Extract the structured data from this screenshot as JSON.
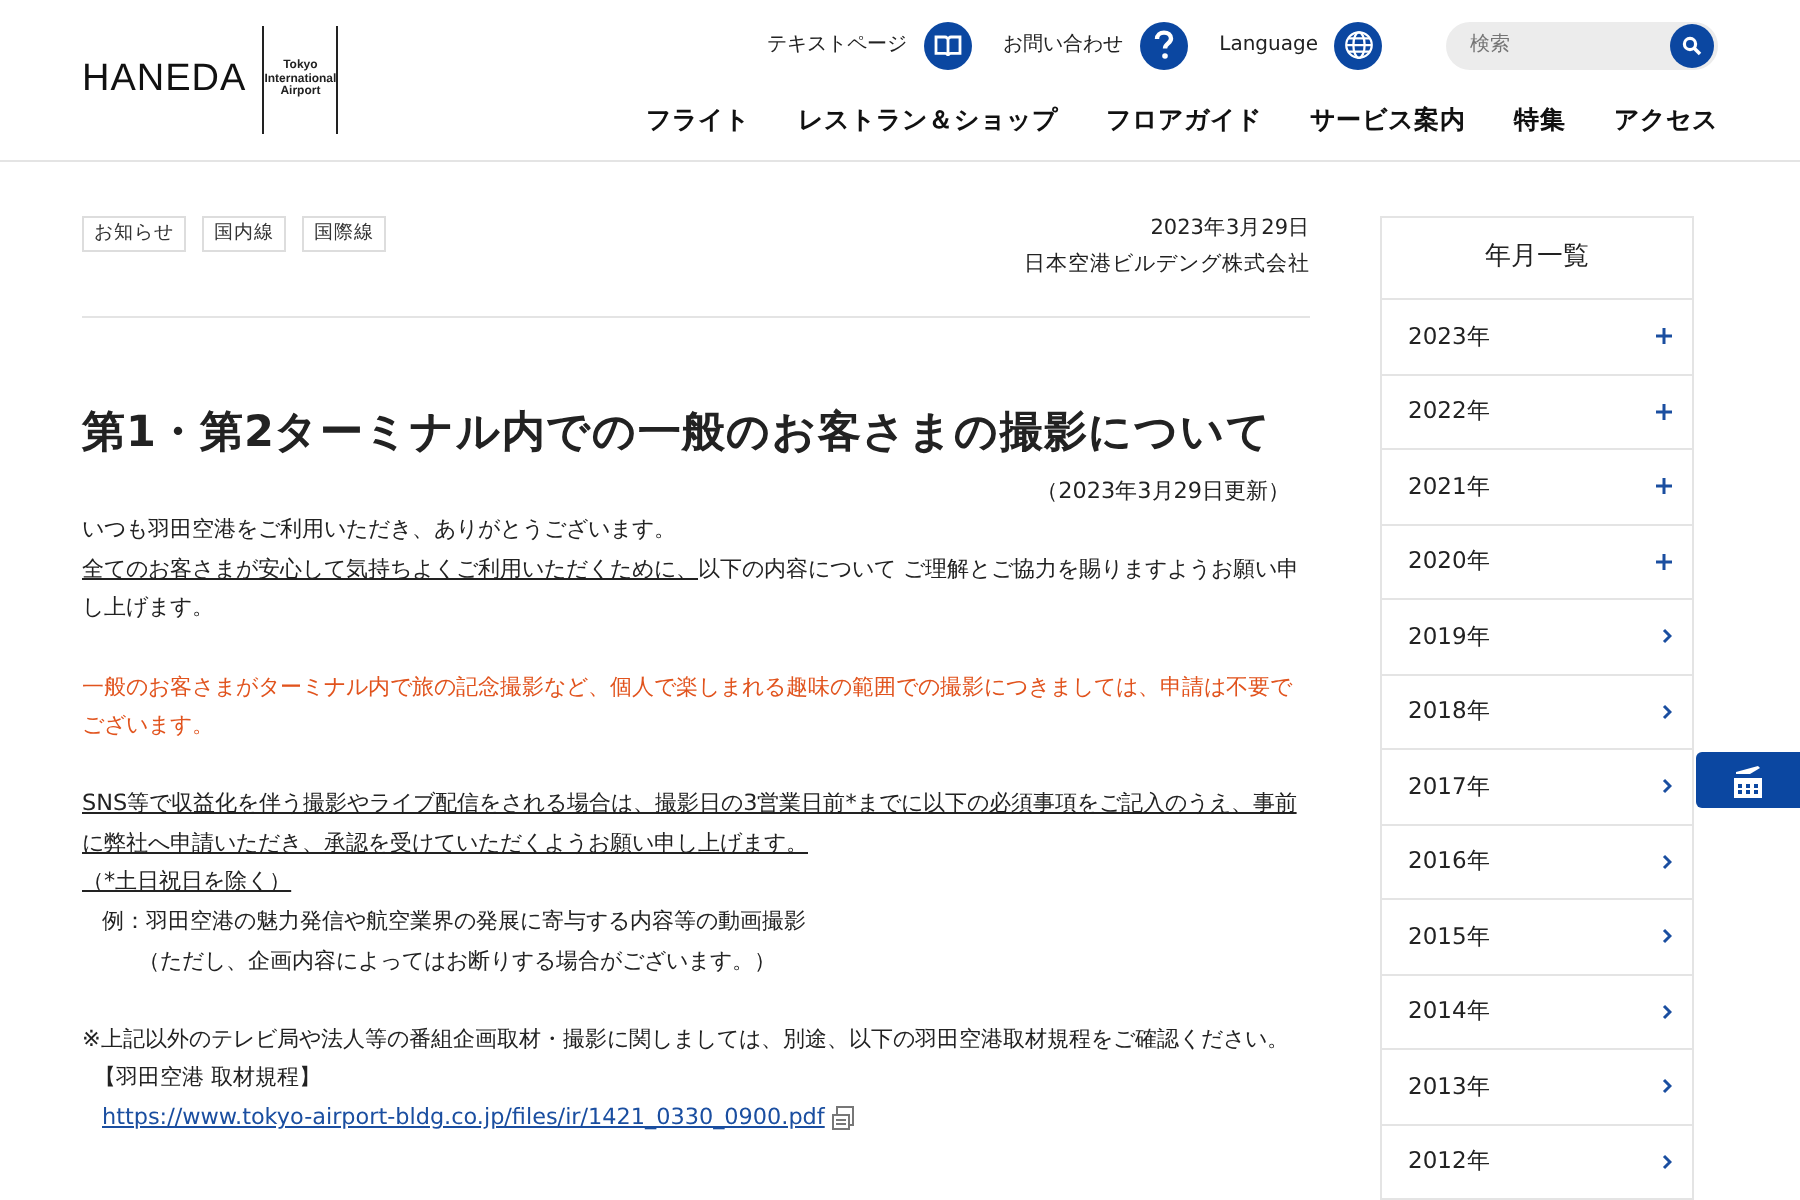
{
  "logo": {
    "name": "HANEDA",
    "subtitle": "Tokyo International Airport"
  },
  "utility_links": [
    {
      "label": "テキストページ"
    },
    {
      "label": "お問い合わせ"
    },
    {
      "label": "Language"
    }
  ],
  "search": {
    "placeholder": "検索"
  },
  "nav": [
    "フライト",
    "レストラン＆ショップ",
    "フロアガイド",
    "サービス案内",
    "特集",
    "アクセス"
  ],
  "article": {
    "tags": [
      "お知らせ",
      "国内線",
      "国際線"
    ],
    "date": "2023年3月29日",
    "author": "日本空港ビルデング株式会社",
    "title": "第1・第2ターミナル内での一般のお客さまの撮影について",
    "updated": "（2023年3月29日更新）",
    "paragraphs": [
      {
        "lines": [
          {
            "kind": "plain",
            "text": "いつも羽田空港をご利用いただき、ありがとうございます。"
          },
          {
            "kind": "mixed",
            "segments": [
              {
                "text": "全てのお客さまが安心して気持ちよくご利用いただくために、",
                "underline": true
              },
              {
                "text": "以下の内容について ご理解とご協力を賜りますようお願い申し上げます。",
                "underline": false
              }
            ]
          }
        ]
      },
      {
        "lines": [
          {
            "kind": "notice",
            "text": "一般のお客さまがターミナル内で旅の記念撮影など、個人で楽しまれる趣味の範囲での撮影につきましては、申請は不要でございます。"
          }
        ]
      },
      {
        "lines": [
          {
            "kind": "underlined",
            "text": "SNS等で収益化を伴う撮影やライブ配信をされる場合は、撮影日の3営業日前*までに以下の必須事項をご記入のうえ、事前に弊社へ申請いただき、承認を受けていただくようお願い申し上げます。"
          },
          {
            "kind": "underlined",
            "text": "（*土日祝日を除く）"
          },
          {
            "kind": "indent1",
            "text": "例：羽田空港の魅力発信や航空業界の発展に寄与する内容等の動画撮影"
          },
          {
            "kind": "indent2",
            "text": "（ただし、企画内容によってはお断りする場合がございます。）"
          }
        ]
      },
      {
        "lines": [
          {
            "kind": "plain",
            "text": "※上記以外のテレビ局や法人等の番組企画取材・撮影に関しましては、別途、以下の羽田空港取材規程をご確認ください。"
          },
          {
            "kind": "label",
            "text": "【羽田空港 取材規程】"
          },
          {
            "kind": "link",
            "text": "https://www.tokyo-airport-bldg.co.jp/files/ir/1421_0330_0900.pdf"
          }
        ]
      }
    ]
  },
  "archive": {
    "title": "年月一覧",
    "years": [
      {
        "label": "2023年",
        "kind": "expand"
      },
      {
        "label": "2022年",
        "kind": "expand"
      },
      {
        "label": "2021年",
        "kind": "expand"
      },
      {
        "label": "2020年",
        "kind": "expand"
      },
      {
        "label": "2019年",
        "kind": "link"
      },
      {
        "label": "2018年",
        "kind": "link"
      },
      {
        "label": "2017年",
        "kind": "link"
      },
      {
        "label": "2016年",
        "kind": "link"
      },
      {
        "label": "2015年",
        "kind": "link"
      },
      {
        "label": "2014年",
        "kind": "link"
      },
      {
        "label": "2013年",
        "kind": "link"
      },
      {
        "label": "2012年",
        "kind": "link"
      }
    ]
  }
}
